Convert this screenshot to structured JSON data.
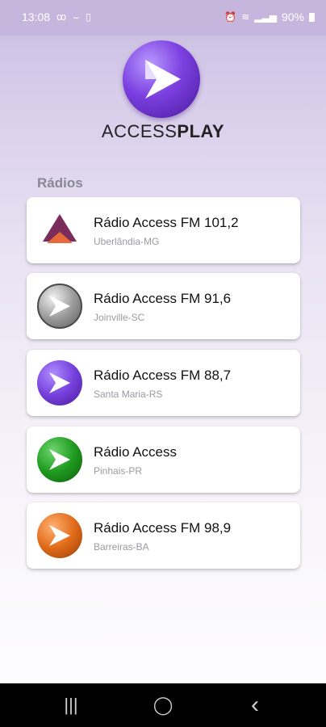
{
  "status": {
    "time": "13:08",
    "battery": "90%",
    "left_icons": [
      "voicemail-icon",
      "call-icon",
      "vibrate-icon"
    ],
    "right_icons": [
      "alarm-icon",
      "wifi-icon",
      "signal-icon",
      "battery-icon"
    ]
  },
  "brand": {
    "part1": "ACCESS",
    "part2": "PLAY"
  },
  "section": {
    "title": "Rádios"
  },
  "stations": [
    {
      "name": "Rádio Access FM 101,2",
      "city": "Uberlândia-MG",
      "icon": "access-fm-logo",
      "color": "#7a2d5a"
    },
    {
      "name": "Rádio Access FM 91,6",
      "city": "Joinville-SC",
      "icon": "play-arrow-icon",
      "color": "#8a8a8a"
    },
    {
      "name": "Rádio Access FM 88,7",
      "city": "Santa Maria-RS",
      "icon": "play-arrow-icon",
      "color": "#7640dc"
    },
    {
      "name": "Rádio Access",
      "city": "Pinhais-PR",
      "icon": "play-arrow-icon",
      "color": "#1f9a1f"
    },
    {
      "name": "Rádio Access FM 98,9",
      "city": "Barreiras-BA",
      "icon": "play-arrow-icon",
      "color": "#e06b1a"
    }
  ],
  "nav": {
    "recent": "|||",
    "home": "◯",
    "back": "‹"
  }
}
